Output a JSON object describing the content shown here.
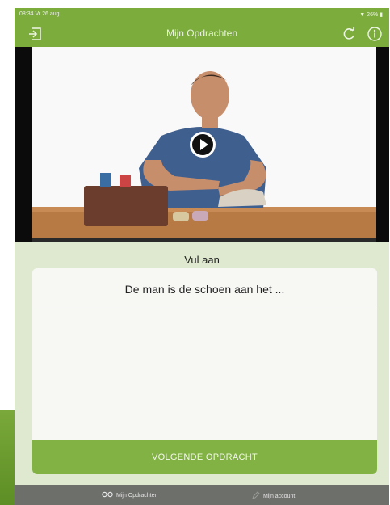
{
  "status_bar": {
    "time": "08:34  Vr 26 aug.",
    "battery": "26%"
  },
  "header": {
    "title": "Mijn Opdrachten"
  },
  "video": {
    "play_label": ""
  },
  "exercise": {
    "heading": "Vul aan",
    "question": "De man is de schoen aan het ...",
    "next_button": "VOLGENDE OPDRACHT"
  },
  "tabs": [
    {
      "label": "Mijn Opdrachten",
      "icon": "glasses-icon"
    },
    {
      "label": "Mijn account",
      "icon": "pencil-icon"
    }
  ],
  "colors": {
    "header": "#7bac3c",
    "background": "#dfe9cf",
    "button": "#82b243",
    "tabbar": "#6d6f6b"
  }
}
